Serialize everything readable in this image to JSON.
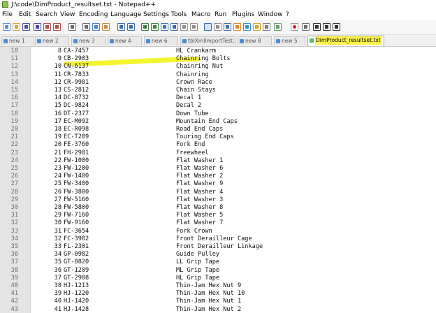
{
  "window": {
    "title": "J:\\code\\DimProduct_resultset.txt - Notepad++"
  },
  "menu": [
    "File",
    "Edit",
    "Search",
    "View",
    "Encoding",
    "Language",
    "Settings",
    "Tools",
    "Macro",
    "Run",
    "Plugins",
    "Window",
    "?"
  ],
  "toolbar_icons": [
    "new-file-icon",
    "open-file-icon",
    "save-icon",
    "save-all-icon",
    "close-icon",
    "close-all-icon",
    "print-icon",
    "cut-icon",
    "copy-icon",
    "paste-icon",
    "undo-icon",
    "redo-icon",
    "find-icon",
    "replace-icon",
    "zoom-in-icon",
    "zoom-out-icon",
    "sync-v-icon",
    "sync-h-icon",
    "word-wrap-icon",
    "show-all-chars-icon",
    "indent-guide-icon",
    "udl-icon",
    "doc-map-icon",
    "function-list-icon",
    "folder-workspace-icon",
    "monitor-icon",
    "record-macro-icon",
    "stop-record-icon",
    "play-macro-icon",
    "run-macro-icon",
    "save-macro-icon"
  ],
  "tabs": [
    {
      "label": "new 1",
      "active": false
    },
    {
      "label": "new 2",
      "active": false
    },
    {
      "label": "new 3",
      "active": false
    },
    {
      "label": "new 4",
      "active": false
    },
    {
      "label": "new 6",
      "active": false
    },
    {
      "label": "tblXmlImportTest.Sql",
      "active": false
    },
    {
      "label": "new 8",
      "active": false
    },
    {
      "label": "new 5",
      "active": false
    },
    {
      "label": "DimProduct_resultset.txt",
      "active": true
    }
  ],
  "colors": {
    "highlight": "#f2f21a",
    "active_tab_highlight": "#fff34a",
    "gutter": "#e4e4e4"
  },
  "rows": [
    {
      "ln": "10",
      "key": "8",
      "code": "CA-7457",
      "name": "HL Crankarm"
    },
    {
      "ln": "11",
      "key": "9",
      "code": "CB-2903",
      "name": "Chainring Bolts"
    },
    {
      "ln": "12",
      "key": "10",
      "code": "CN-6137",
      "name": "Chainring Nut"
    },
    {
      "ln": "13",
      "key": "11",
      "code": "CR-7833",
      "name": "Chainring"
    },
    {
      "ln": "14",
      "key": "12",
      "code": "CR-9981",
      "name": "Crown Race"
    },
    {
      "ln": "15",
      "key": "13",
      "code": "CS-2812",
      "name": "Chain Stays"
    },
    {
      "ln": "16",
      "key": "14",
      "code": "DC-8732",
      "name": "Decal 1"
    },
    {
      "ln": "17",
      "key": "15",
      "code": "DC-9824",
      "name": "Decal 2"
    },
    {
      "ln": "18",
      "key": "16",
      "code": "DT-2377",
      "name": "Down Tube"
    },
    {
      "ln": "19",
      "key": "17",
      "code": "EC-M092",
      "name": "Mountain End Caps"
    },
    {
      "ln": "20",
      "key": "18",
      "code": "EC-R098",
      "name": "Road End Caps"
    },
    {
      "ln": "21",
      "key": "19",
      "code": "EC-T209",
      "name": "Touring End Caps"
    },
    {
      "ln": "22",
      "key": "20",
      "code": "FE-3760",
      "name": "Fork End"
    },
    {
      "ln": "23",
      "key": "21",
      "code": "FH-2981",
      "name": "Freewheel"
    },
    {
      "ln": "24",
      "key": "22",
      "code": "FW-1000",
      "name": "Flat Washer 1"
    },
    {
      "ln": "25",
      "key": "23",
      "code": "FW-1200",
      "name": "Flat Washer 6"
    },
    {
      "ln": "26",
      "key": "24",
      "code": "FW-1400",
      "name": "Flat Washer 2"
    },
    {
      "ln": "27",
      "key": "25",
      "code": "FW-3400",
      "name": "Flat Washer 9"
    },
    {
      "ln": "28",
      "key": "26",
      "code": "FW-3800",
      "name": "Flat Washer 4"
    },
    {
      "ln": "29",
      "key": "27",
      "code": "FW-5160",
      "name": "Flat Washer 3"
    },
    {
      "ln": "30",
      "key": "28",
      "code": "FW-5800",
      "name": "Flat Washer 8"
    },
    {
      "ln": "31",
      "key": "29",
      "code": "FW-7160",
      "name": "Flat Washer 5"
    },
    {
      "ln": "32",
      "key": "30",
      "code": "FW-9160",
      "name": "Flat Washer 7"
    },
    {
      "ln": "33",
      "key": "31",
      "code": "FC-3654",
      "name": "Fork Crown"
    },
    {
      "ln": "34",
      "key": "32",
      "code": "FC-3982",
      "name": "Front Derailleur Cage"
    },
    {
      "ln": "35",
      "key": "33",
      "code": "FL-2301",
      "name": "Front Derailleur Linkage"
    },
    {
      "ln": "36",
      "key": "34",
      "code": "GP-0982",
      "name": "Guide Pulley"
    },
    {
      "ln": "37",
      "key": "35",
      "code": "GT-0820",
      "name": "LL Grip Tape"
    },
    {
      "ln": "38",
      "key": "36",
      "code": "GT-1209",
      "name": "ML Grip Tape"
    },
    {
      "ln": "39",
      "key": "37",
      "code": "GT-2908",
      "name": "HL Grip Tape"
    },
    {
      "ln": "40",
      "key": "38",
      "code": "HJ-1213",
      "name": "Thin-Jam Hex Nut 9"
    },
    {
      "ln": "41",
      "key": "39",
      "code": "HJ-1220",
      "name": "Thin-Jam Hex Nut 10"
    },
    {
      "ln": "42",
      "key": "40",
      "code": "HJ-1420",
      "name": "Thin-Jam Hex Nut 1"
    },
    {
      "ln": "43",
      "key": "41",
      "code": "HJ-1428",
      "name": "Thin-Jam Hex Nut 2"
    }
  ]
}
